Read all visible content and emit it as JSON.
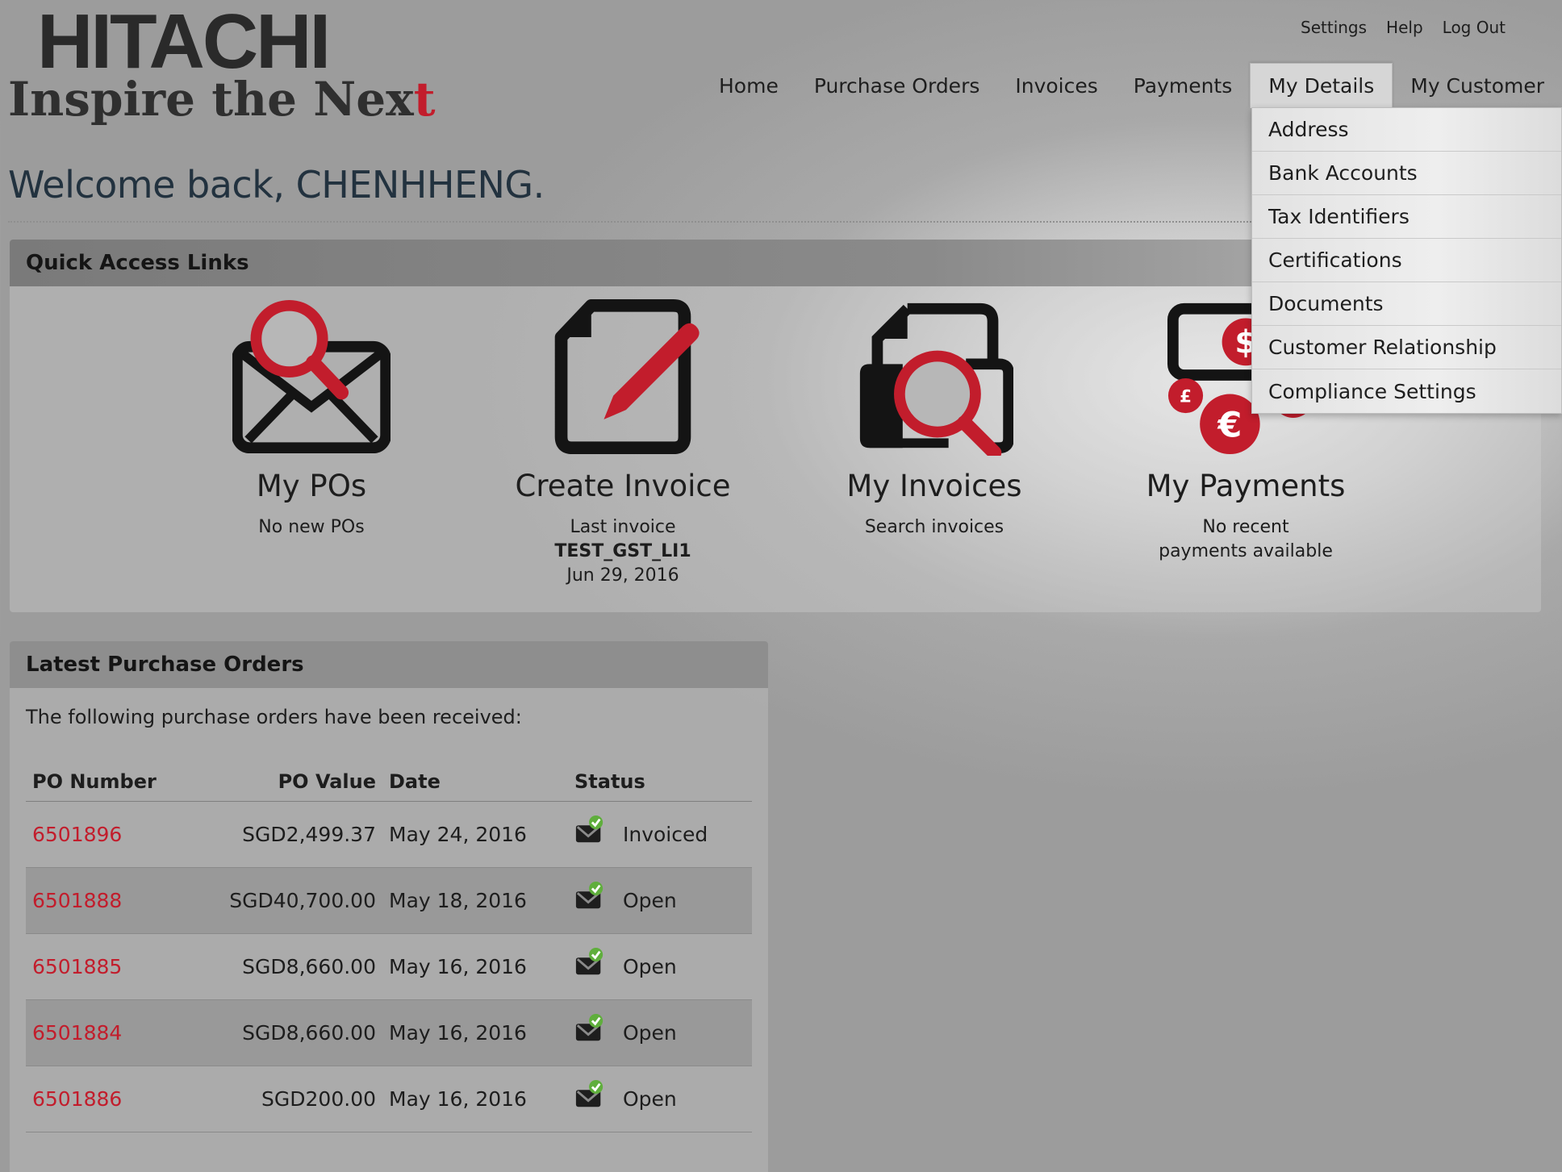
{
  "logo": {
    "brand": "HITACHI",
    "tagline_main": "Inspire the Nex",
    "tagline_accent": "t"
  },
  "util_nav": {
    "settings": "Settings",
    "help": "Help",
    "logout": "Log Out"
  },
  "main_nav": {
    "home": "Home",
    "purchase_orders": "Purchase Orders",
    "invoices": "Invoices",
    "payments": "Payments",
    "my_details": "My Details",
    "my_customer": "My Customer"
  },
  "dropdown": {
    "address": "Address",
    "bank_accounts": "Bank Accounts",
    "tax_identifiers": "Tax Identifiers",
    "certifications": "Certifications",
    "documents": "Documents",
    "customer_relationship": "Customer Relationship",
    "compliance_settings": "Compliance Settings"
  },
  "welcome": "Welcome back, CHENHHENG.",
  "quick_access": {
    "title": "Quick Access Links",
    "my_pos": {
      "title": "My POs",
      "sub": "No new POs"
    },
    "create_invoice": {
      "title": "Create Invoice",
      "sub": "Last invoice",
      "invoice_id": "TEST_GST_LI1",
      "date": "Jun 29, 2016"
    },
    "my_invoices": {
      "title": "My Invoices",
      "sub": "Search invoices"
    },
    "my_payments": {
      "title": "My Payments",
      "sub_line1": "No recent",
      "sub_line2": "payments available"
    }
  },
  "latest_pos": {
    "title": "Latest Purchase Orders",
    "intro": "The following purchase orders have been received:",
    "columns": {
      "number": "PO Number",
      "value": "PO Value",
      "date": "Date",
      "status": "Status"
    },
    "rows": [
      {
        "number": "6501896",
        "value": "SGD2,499.37",
        "date": "May 24, 2016",
        "status": "Invoiced"
      },
      {
        "number": "6501888",
        "value": "SGD40,700.00",
        "date": "May 18, 2016",
        "status": "Open"
      },
      {
        "number": "6501885",
        "value": "SGD8,660.00",
        "date": "May 16, 2016",
        "status": "Open"
      },
      {
        "number": "6501884",
        "value": "SGD8,660.00",
        "date": "May 16, 2016",
        "status": "Open"
      },
      {
        "number": "6501886",
        "value": "SGD200.00",
        "date": "May 16, 2016",
        "status": "Open"
      }
    ]
  },
  "colors": {
    "brand_red": "#c21d2c",
    "dark_icon": "#141414",
    "welcome_text": "#22323f",
    "status_green": "#5fae3c"
  },
  "icons": {
    "my_pos": "envelope-magnifier-icon",
    "create_invoice": "document-pencil-icon",
    "my_invoices": "document-magnifier-icon",
    "my_payments": "currency-coins-icon",
    "status": "envelope-check-icon"
  }
}
